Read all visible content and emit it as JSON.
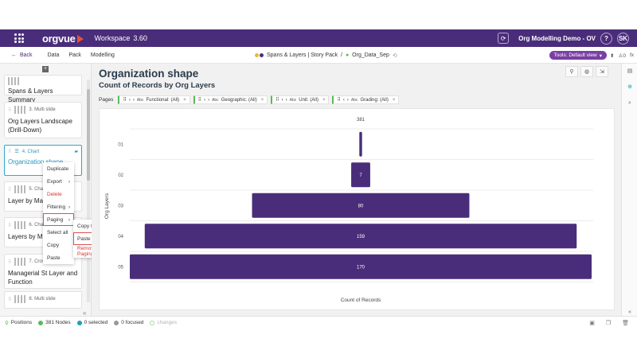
{
  "topbar": {
    "app_name": "orgvue",
    "workspace_label": "Workspace",
    "workspace_version": "3.60",
    "demo_name": "Org Modelling Demo - OV",
    "help": "?",
    "user_initials": "SK"
  },
  "nav": {
    "back": "Back",
    "menu": [
      "Data",
      "Pack",
      "Modelling"
    ],
    "story_pack": "Spans & Layers | Story Pack",
    "separator": "/",
    "dataset": "Org_Data_Sep",
    "tools_label": "Tools: Default view",
    "counter": "0",
    "fx": "fx"
  },
  "slides": [
    {
      "type": "",
      "title": "Spans & Layers Summary"
    },
    {
      "type": "3. Multi slide",
      "title": "Org Layers Landscape (Drill-Down)"
    },
    {
      "type": "4. Chart",
      "title": "Organization shape"
    },
    {
      "type": "5. Char",
      "title": "Layer by Mana Status"
    },
    {
      "type": "6. Char",
      "title": "Layers by Mar Level"
    },
    {
      "type": "7. Cross",
      "title": "Managerial St Layer and Function"
    },
    {
      "type": "8. Multi slide",
      "title": ""
    }
  ],
  "context_menu": {
    "items": [
      "Duplicate",
      "Export",
      "Delete",
      "Filtering",
      "Paging",
      "Select all",
      "Copy",
      "Paste"
    ],
    "submenu": [
      "Copy Paging",
      "Paste Paging",
      "Remove Paging"
    ]
  },
  "main": {
    "page_title": "Organization shape",
    "chart_title": "Count of Records by Org Layers",
    "pages_label": "Pages",
    "pagers": [
      {
        "abc": "Abc",
        "label": "Functional: (All)"
      },
      {
        "abc": "Abc",
        "label": "Geographic: (All)"
      },
      {
        "abc": "Abc",
        "label": "Unit: (All)"
      },
      {
        "abc": "Abc",
        "label": "Grading: (All)"
      }
    ]
  },
  "chart_data": {
    "type": "bar",
    "orientation": "horizontal-centered",
    "categories": [
      "01",
      "02",
      "03",
      "04",
      "05"
    ],
    "values": [
      1,
      7,
      80,
      159,
      170
    ],
    "data_labels": [
      "1",
      "7",
      "80",
      "159",
      "170"
    ],
    "total_label": "381",
    "xlabel": "Count of Records",
    "ylabel": "Org Layers",
    "bar_color": "#4a2d7a",
    "grid": true
  },
  "status": {
    "positions": "Positions",
    "nodes": "381 Nodes",
    "selected": "0 selected",
    "focused": "0 focused",
    "changes": "changes"
  },
  "colors": {
    "brand": "#4a2d7a",
    "accent": "#33a7c9",
    "danger": "#d9342b",
    "tools": "#7a3fa3"
  }
}
